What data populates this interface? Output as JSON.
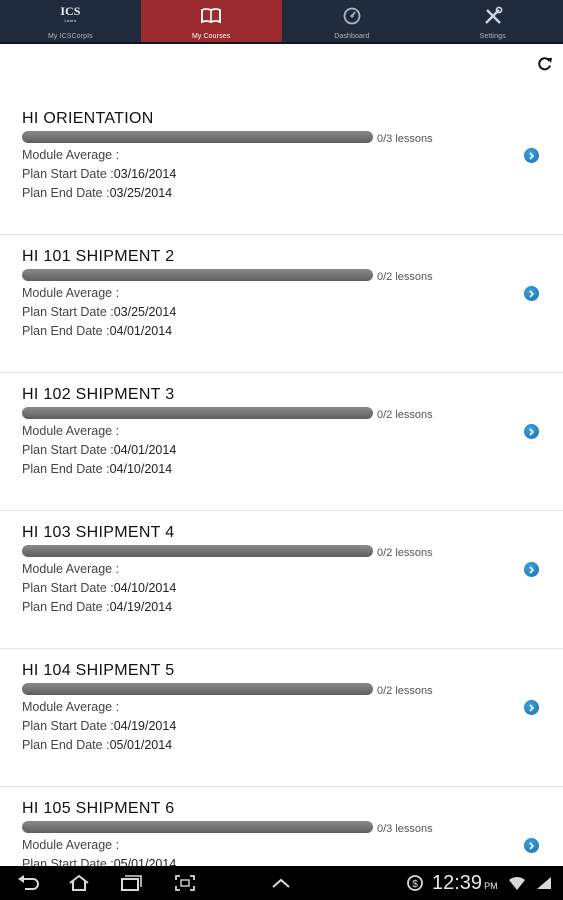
{
  "tabs": [
    {
      "label": "My ICSCorpIs",
      "icon": "ics-logo-icon",
      "logo_text": "ICS",
      "logo_sub": "Learn"
    },
    {
      "label": "My Courses",
      "icon": "book-icon",
      "active": true
    },
    {
      "label": "Dashboard",
      "icon": "dashboard-gauge-icon"
    },
    {
      "label": "Settings",
      "icon": "wrench-screwdriver-icon"
    }
  ],
  "toolbar": {
    "refresh_icon": "refresh-icon"
  },
  "labels": {
    "module_average": "Module Average :",
    "plan_start": "Plan Start Date :",
    "plan_end": "Plan End Date :"
  },
  "courses": [
    {
      "title": "HI ORIENTATION",
      "lessons": "0/3 lessons",
      "progress": 0,
      "start": "03/16/2014",
      "end": "03/25/2014"
    },
    {
      "title": "HI 101 SHIPMENT 2",
      "lessons": "0/2 lessons",
      "progress": 0,
      "start": "03/25/2014",
      "end": "04/01/2014"
    },
    {
      "title": "HI 102 SHIPMENT 3",
      "lessons": "0/2 lessons",
      "progress": 0,
      "start": "04/01/2014",
      "end": "04/10/2014"
    },
    {
      "title": "HI 103 SHIPMENT 4",
      "lessons": "0/2 lessons",
      "progress": 0,
      "start": "04/10/2014",
      "end": "04/19/2014"
    },
    {
      "title": "HI 104 SHIPMENT 5",
      "lessons": "0/2 lessons",
      "progress": 0,
      "start": "04/19/2014",
      "end": "05/01/2014"
    },
    {
      "title": "HI 105 SHIPMENT 6",
      "lessons": "0/3 lessons",
      "progress": 0,
      "start": "05/01/2014",
      "end": ""
    }
  ],
  "system_bar": {
    "time": "12:39",
    "ampm": "PM",
    "buttons": [
      "back-icon",
      "home-icon",
      "recent-apps-icon",
      "screenshot-icon",
      "menu-up-icon"
    ],
    "status_icons": [
      "notification-icon",
      "wifi-icon",
      "battery-icon"
    ]
  },
  "colors": {
    "header_bg": "#1f2a3a",
    "active_tab": "#9b2b2f",
    "arrow_blue": "#1e88cc"
  }
}
